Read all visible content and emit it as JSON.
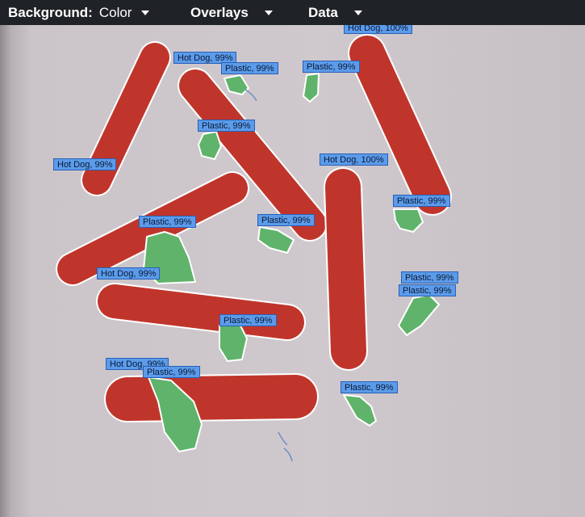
{
  "toolbar": {
    "background_label": "Background:",
    "background_value": "Color",
    "overlays_label": "Overlays",
    "data_label": "Data"
  },
  "detections": [
    {
      "label": "Hot Dog, 100%"
    },
    {
      "label": "Hot Dog, 99%"
    },
    {
      "label": "Plastic, 99%"
    },
    {
      "label": "Plastic, 99%"
    },
    {
      "label": "Plastic, 99%"
    },
    {
      "label": "Hot Dog, 99%"
    },
    {
      "label": "Hot Dog, 100%"
    },
    {
      "label": "Plastic, 99%"
    },
    {
      "label": "Plastic, 99%"
    },
    {
      "label": "Plastic, 99%"
    },
    {
      "label": "Hot Dog, 99%"
    },
    {
      "label": "Plastic, 99%"
    },
    {
      "label": "Plastic, 99%"
    },
    {
      "label": "Plastic, 99%"
    },
    {
      "label": "Hot Dog, 99%"
    },
    {
      "label": "Plastic, 99%"
    },
    {
      "label": "Plastic, 99%"
    }
  ],
  "colors": {
    "hot_dog_mask": "#c0352b",
    "plastic_mask": "#5fb36a",
    "label_bg": "#5b9bea",
    "outline": "#ffffff"
  }
}
